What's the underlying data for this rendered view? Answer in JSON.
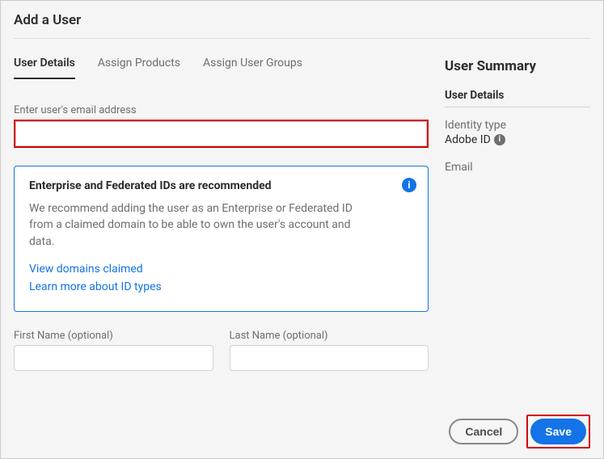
{
  "dialog": {
    "title": "Add a User"
  },
  "tabs": [
    {
      "label": "User Details",
      "active": true
    },
    {
      "label": "Assign Products",
      "active": false
    },
    {
      "label": "Assign User Groups",
      "active": false
    }
  ],
  "form": {
    "email_label": "Enter user's email address",
    "email_value": "",
    "first_name_label": "First Name (optional)",
    "first_name_value": "",
    "last_name_label": "Last Name (optional)",
    "last_name_value": ""
  },
  "callout": {
    "title": "Enterprise and Federated IDs are recommended",
    "body": "We recommend adding the user as an Enterprise or Federated ID from a claimed domain to be able to own the user's account and data.",
    "link1": "View domains claimed",
    "link2": "Learn more about ID types",
    "info_icon": "info-icon"
  },
  "summary": {
    "title": "User Summary",
    "section_label": "User Details",
    "identity_type_label": "Identity type",
    "identity_type_value": "Adobe ID",
    "email_label": "Email"
  },
  "footer": {
    "cancel_label": "Cancel",
    "save_label": "Save"
  }
}
